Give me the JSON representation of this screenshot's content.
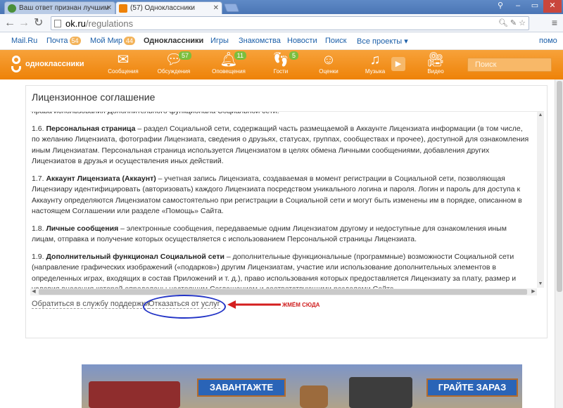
{
  "browser": {
    "tabs": [
      {
        "title": "Ваш ответ признан лучшим"
      },
      {
        "title": "(57) Одноклассники"
      }
    ],
    "url_host": "ok.ru",
    "url_path": "/regulations"
  },
  "mailbar": {
    "items": [
      {
        "label": "Mail.Ru"
      },
      {
        "label": "Почта",
        "badge": "54"
      },
      {
        "label": "Мой Мир",
        "badge": "44"
      },
      {
        "label": "Одноклассники"
      },
      {
        "label": "Игры"
      },
      {
        "label": "Знакомства"
      },
      {
        "label": "Новости"
      },
      {
        "label": "Поиск"
      },
      {
        "label": "Все проекты ▾"
      }
    ],
    "help": "помо"
  },
  "okheader": {
    "logo": "одноклассники",
    "nav": [
      {
        "label": "Сообщения",
        "count": ""
      },
      {
        "label": "Обсуждения",
        "count": "57"
      },
      {
        "label": "Оповещения",
        "count": "11"
      },
      {
        "label": "Гости",
        "count": "5"
      },
      {
        "label": "Оценки",
        "count": ""
      },
      {
        "label": "Музыка",
        "count": ""
      },
      {
        "label": "Видео",
        "count": ""
      }
    ],
    "search_placeholder": "Поиск"
  },
  "page": {
    "title": "Лицензионное соглашение",
    "fragment_top": "права использования Дополнительного функционала Социальной сети.",
    "clauses": [
      {
        "num": "1.6.",
        "term": "Персональная страница",
        "text": " – раздел Социальной сети, содержащий часть размещаемой в Аккаунте Лицензиата информации (в том числе, по желанию Лицензиата, фотографии Лицензиата, сведения о друзьях, статусах, группах, сообществах и прочее), доступной для ознакомления иным Лицензиатам. Персональная страница используется Лицензиатом в целях обмена Личными сообщениями, добавления других Лицензиатов в друзья и осуществления иных действий."
      },
      {
        "num": "1.7.",
        "term": "Аккаунт Лицензиата (Аккаунт)",
        "text": " – учетная запись Лицензиата, создаваемая в момент регистрации в Социальной сети, позволяющая Лицензиару идентифицировать (авторизовать) каждого Лицензиата посредством уникального логина и пароля. Логин и пароль для доступа к Аккаунту определяются Лицензиатом самостоятельно при регистрации в Социальной сети и могут быть изменены им в порядке, описанном в настоящем Соглашении или разделе «Помощь» Сайта."
      },
      {
        "num": "1.8.",
        "term": "Личные сообщения",
        "text": " – электронные сообщения, передаваемые одним Лицензиатом другому и недоступные для ознакомления иным лицам, отправка и получение которых осуществляется с использованием Персональной страницы Лицензиата."
      },
      {
        "num": "1.9.",
        "term": "Дополнительный функционал Социальной сети",
        "text": " – дополнительные функциональные (программные) возможности Социальной сети (направление графических изображений («подарков») другим Лицензиатам, участие или использование дополнительных элементов в определенных играх, входящих в состав Приложений и т. д.), право использования которых предоставляется Лицензиату за плату, размер и условия внесения которой определены настоящим Соглашением и соответствующими разделами Сайта."
      }
    ],
    "link_support": "Обратиться в службу поддержки",
    "link_refuse": "Отказаться от услуг",
    "annotation": "ЖМЁМ СЮДА"
  },
  "banner": {
    "button1": "ЗАВАНТАЖТЕ",
    "button2": "ГРАЙТЕ ЗАРАЗ"
  }
}
